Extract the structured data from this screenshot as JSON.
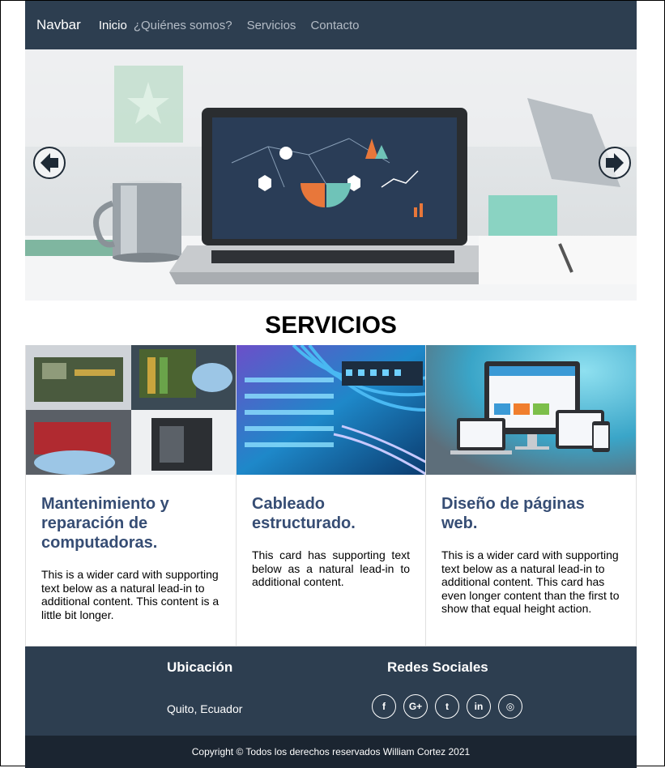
{
  "navbar": {
    "brand": "Navbar",
    "links": [
      {
        "label": "Inicio",
        "active": true
      },
      {
        "label": "¿Quiénes somos?",
        "active": false
      },
      {
        "label": "Servicios",
        "active": false
      },
      {
        "label": "Contacto",
        "active": false
      }
    ]
  },
  "carousel": {
    "prev_icon": "arrow-left-icon",
    "next_icon": "arrow-right-icon"
  },
  "section": {
    "title": "SERVICIOS"
  },
  "cards": [
    {
      "title": "Mantenimiento y reparación de computadoras.",
      "text": "This is a wider card with supporting text below as a natural lead-in to additional content. This content is a little bit longer."
    },
    {
      "title": "Cableado estructurado.",
      "text": "This card has supporting text below as a natural lead-in to additional content."
    },
    {
      "title": "Diseño de páginas web.",
      "text": "This is a wider card with supporting text below as a natural lead-in to additional content. This card has even longer content than the first to show that equal height action."
    }
  ],
  "footer": {
    "location_title": "Ubicación",
    "location_text": "Quito, Ecuador",
    "social_title": "Redes Sociales",
    "socials": [
      {
        "icon": "facebook-icon",
        "glyph": "f"
      },
      {
        "icon": "google-plus-icon",
        "glyph": "G+"
      },
      {
        "icon": "twitter-icon",
        "glyph": "t"
      },
      {
        "icon": "linkedin-icon",
        "glyph": "in"
      },
      {
        "icon": "dribbble-icon",
        "glyph": "◎"
      }
    ],
    "copyright": "Copyright © Todos los derechos reservados William Cortez 2021"
  },
  "colors": {
    "navbar_bg": "#2d3e50",
    "footer_bg": "#2d3e50",
    "copyright_bg": "#1b2531",
    "card_title": "#364d74"
  }
}
